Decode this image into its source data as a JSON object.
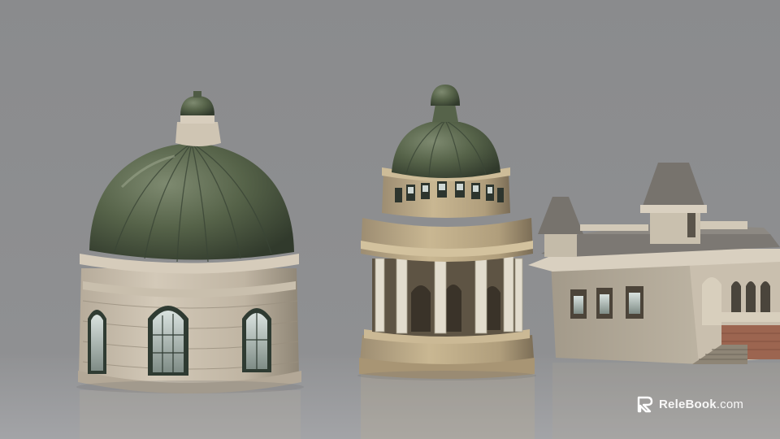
{
  "scene": {
    "description_color_sky": "#8e8f91",
    "floor_color": "#9a9b9e",
    "copper_color": "#5c6a52",
    "stone_color": "#c9bfae"
  },
  "watermark": {
    "brand": "ReleBook",
    "suffix": ".com",
    "logo_icon": "relebook-logo-icon"
  }
}
